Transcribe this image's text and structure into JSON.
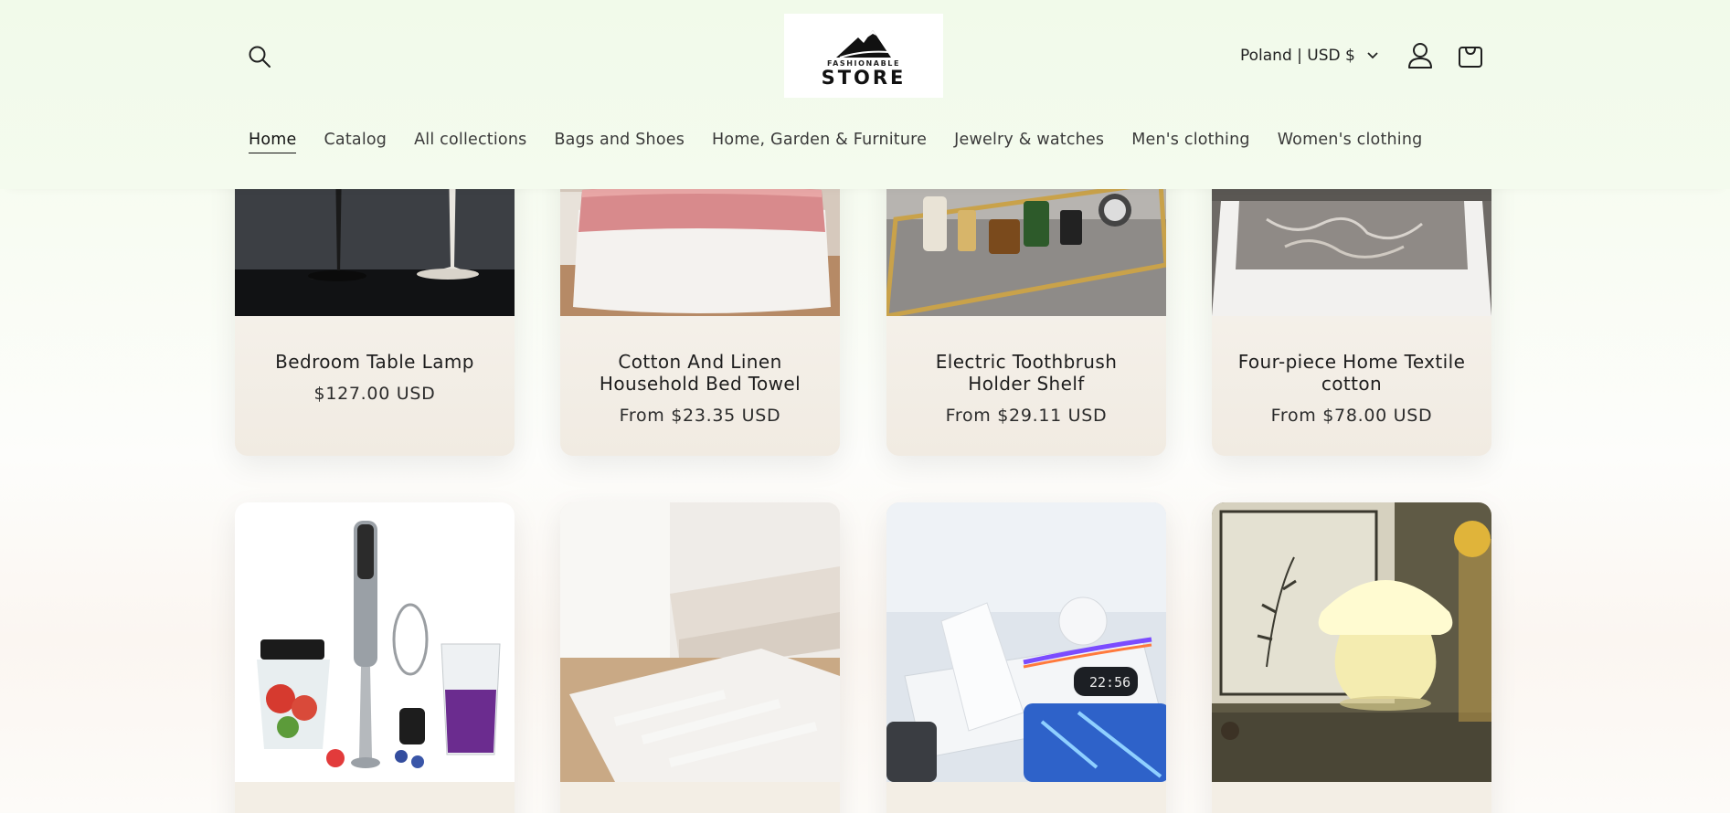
{
  "header": {
    "logo": {
      "line1": "FASHIONABLE",
      "line2": "STORE"
    },
    "locale": "Poland | USD $",
    "icons": {
      "search": "search-icon",
      "account": "user-icon",
      "cart": "bag-icon",
      "locale_caret": "chevron-down-icon"
    }
  },
  "nav": {
    "items": [
      {
        "label": "Home",
        "active": true
      },
      {
        "label": "Catalog"
      },
      {
        "label": "All collections"
      },
      {
        "label": "Bags and Shoes"
      },
      {
        "label": "Home, Garden & Furniture"
      },
      {
        "label": "Jewelry & watches"
      },
      {
        "label": "Men's clothing"
      },
      {
        "label": "Women's clothing"
      }
    ]
  },
  "products": [
    {
      "title": "Bedroom Table Lamp",
      "price": "$127.00 USD"
    },
    {
      "title": "Cotton And Linen Household Bed Towel",
      "price": "From $23.35 USD"
    },
    {
      "title": "Electric Toothbrush Holder Shelf",
      "price": "From $29.11 USD"
    },
    {
      "title": "Four-piece Home Textile cotton",
      "price": "From $78.00 USD"
    }
  ],
  "products_row2": [
    {
      "image": "hand blender set"
    },
    {
      "image": "white shag rug in living room"
    },
    {
      "image": "wireless charging station"
    },
    {
      "image": "mushroom table lamp"
    }
  ]
}
